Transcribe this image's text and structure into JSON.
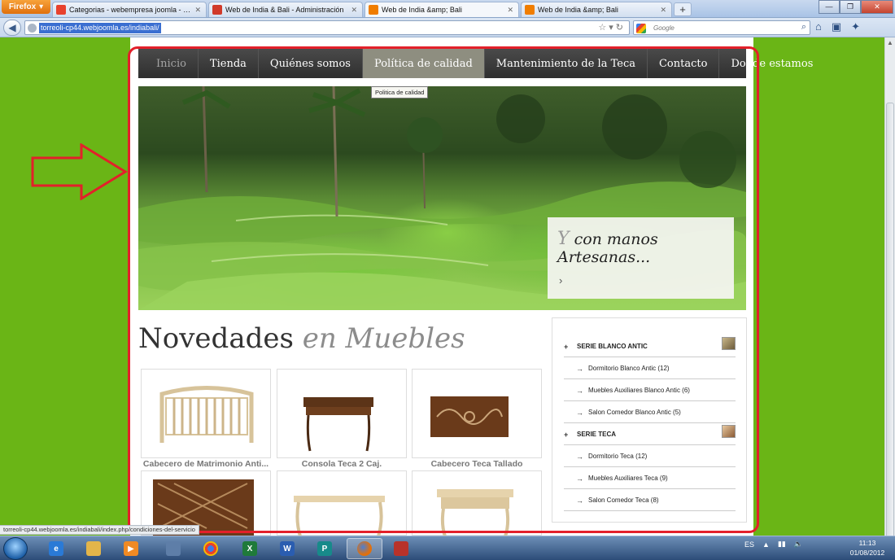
{
  "browser": {
    "app_button": "Firefox",
    "tabs": [
      {
        "label": "Categorias - webempresa joomla - Hosting Jo...",
        "color": "#e8412d"
      },
      {
        "label": "Web de India & Bali - Administración",
        "color": "#d13a2a"
      },
      {
        "label": "Web de India &amp; Bali",
        "color": "#f07d00"
      },
      {
        "label": "Web de India &amp; Bali",
        "color": "#f07d00"
      }
    ],
    "url": "torreoli-cp44.webjoomla.es/indiabali/",
    "search_placeholder": "Google",
    "status_url": "torreoli-cp44.webjoomla.es/indiabali/index.php/condiciones-del-servicio"
  },
  "site": {
    "menu": [
      "Inicio",
      "Tienda",
      "Quiénes somos",
      "Política de calidad",
      "Mantenimiento de la Teca",
      "Contacto",
      "Donde estamos"
    ],
    "active_menu_index": 3,
    "tooltip": "Politica de calidad",
    "hero": {
      "initial": "Y",
      "line1_rest": " con manos",
      "line2": "Artesanas...",
      "next_symbol": "›"
    },
    "heading": {
      "plain": "Novedades",
      "italic": "en Muebles"
    },
    "products": [
      {
        "title": "Cabecero de Matrimonio Anti...",
        "kind": "headboard-light"
      },
      {
        "title": "Consola Teca 2 Caj.",
        "kind": "console-dark"
      },
      {
        "title": "Cabecero Teca Tallado",
        "kind": "carved-panel"
      },
      {
        "title": "",
        "kind": "headboard-lattice"
      },
      {
        "title": "",
        "kind": "table-light"
      },
      {
        "title": "",
        "kind": "desk-light"
      }
    ],
    "categories": [
      {
        "label": "SERIE BLANCO ANTIC",
        "type": "head"
      },
      {
        "label": "Dormitorio Blanco Antic (12)",
        "type": "sub"
      },
      {
        "label": "Muebles Auxiliares Blanco Antic (6)",
        "type": "sub"
      },
      {
        "label": "Salon Comedor Blanco Antic (5)",
        "type": "sub"
      },
      {
        "label": "SERIE TECA",
        "type": "head"
      },
      {
        "label": "Dormitorio Teca (12)",
        "type": "sub"
      },
      {
        "label": "Muebles Auxiliares Teca (9)",
        "type": "sub"
      },
      {
        "label": "Salon Comedor Teca (8)",
        "type": "sub"
      }
    ]
  },
  "taskbar": {
    "language": "ES",
    "time": "11:13",
    "date": "01/08/2012"
  },
  "colors": {
    "desktop_green": "#6ab516",
    "highlight_red": "#e3202a",
    "menu_dark": "#3a3a3a"
  }
}
